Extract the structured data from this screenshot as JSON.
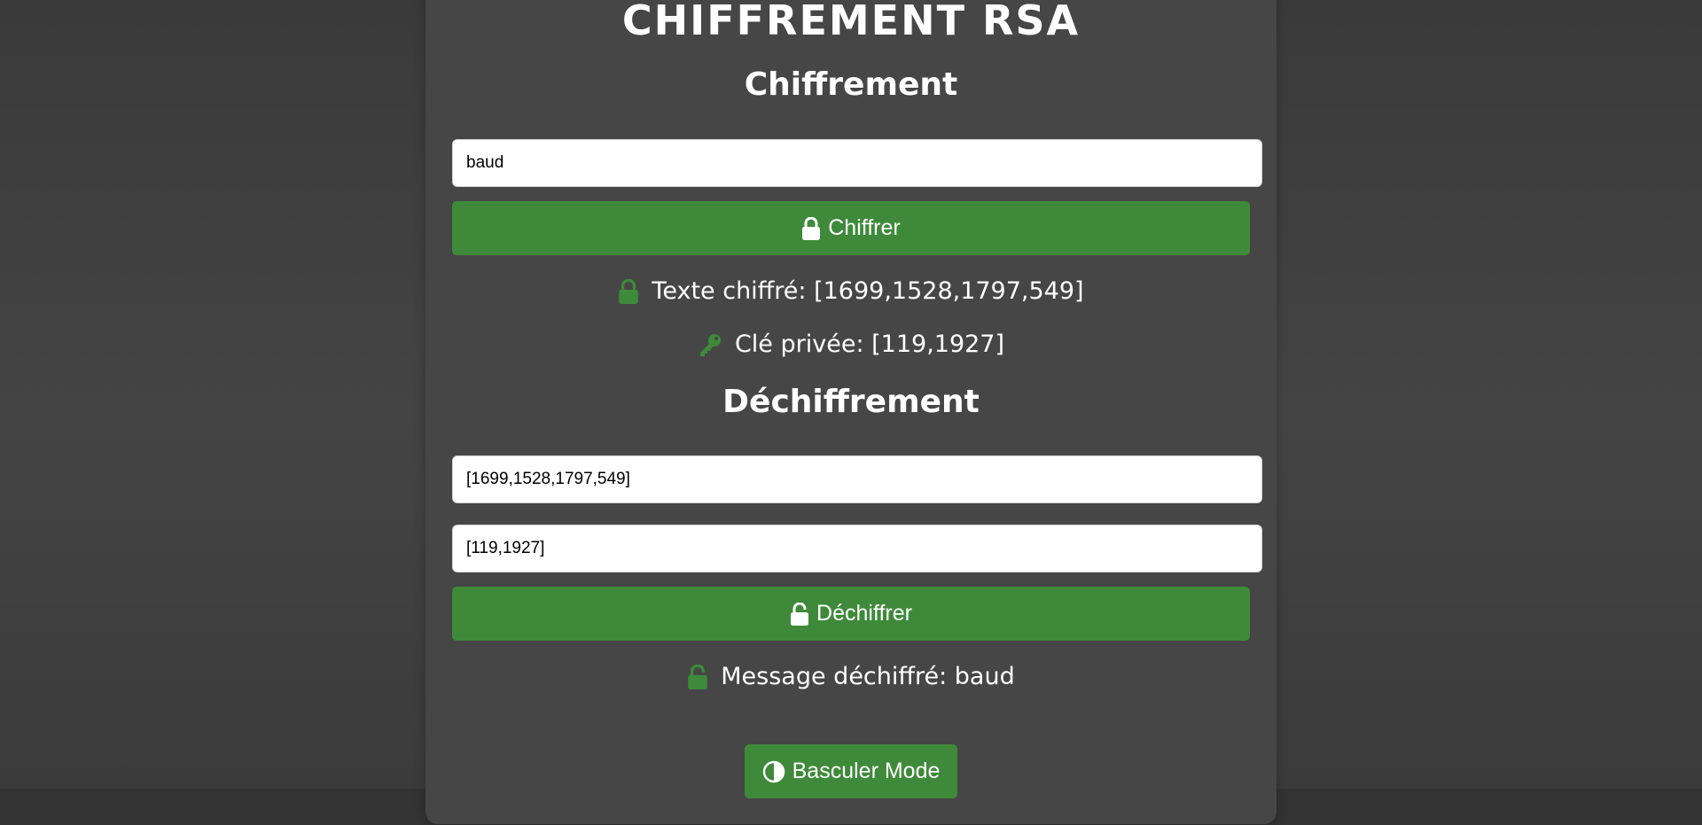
{
  "app": {
    "title": "CHIFFREMENT RSA"
  },
  "encrypt": {
    "heading": "Chiffrement",
    "input_value": "baud",
    "button_label": "Chiffrer",
    "result_text": "Texte chiffré: [1699,1528,1797,549]",
    "private_key_text": "Clé privée: [119,1927]"
  },
  "decrypt": {
    "heading": "Déchiffrement",
    "cipher_input_value": "[1699,1528,1797,549]",
    "key_input_value": "[119,1927]",
    "button_label": "Déchiffrer",
    "result_text": "Message déchiffré: baud"
  },
  "toggle": {
    "button_label": "Basculer Mode"
  },
  "icons": {
    "encrypt_button": "lock-icon",
    "cipher_result": "lock-icon",
    "private_key": "key-icon",
    "decrypt_button": "unlock-icon",
    "decrypted_result": "unlock-icon",
    "toggle_button": "contrast-icon"
  },
  "colors": {
    "accent_green": "#3e8a3a",
    "card_background": "#464646",
    "page_background": "#3a3a3a"
  }
}
